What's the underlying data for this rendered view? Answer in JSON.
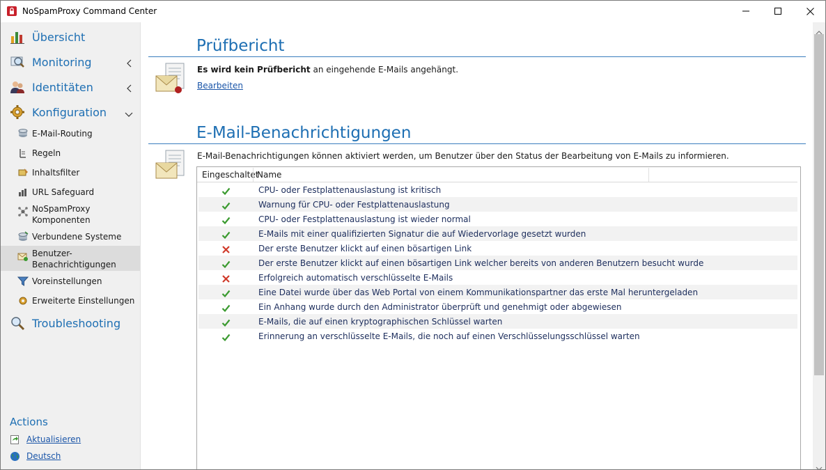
{
  "window": {
    "title": "NoSpamProxy Command Center"
  },
  "sidebar": {
    "main_items": [
      {
        "label": "Übersicht",
        "icon": "overview-chart-icon",
        "chevron": ""
      },
      {
        "label": "Monitoring",
        "icon": "monitoring-magnifier-icon",
        "chevron": "left"
      },
      {
        "label": "Identitäten",
        "icon": "identities-users-icon",
        "chevron": "left"
      },
      {
        "label": "Konfiguration",
        "icon": "configuration-gear-icon",
        "chevron": "down"
      }
    ],
    "sub_items": [
      {
        "label": "E-Mail-Routing",
        "icon": "email-routing-icon"
      },
      {
        "label": "Regeln",
        "icon": "rules-icon"
      },
      {
        "label": "Inhaltsfilter",
        "icon": "content-filter-icon"
      },
      {
        "label": "URL Safeguard",
        "icon": "url-safeguard-icon"
      },
      {
        "label": "NoSpamProxy",
        "label2": "Komponenten",
        "icon": "components-icon"
      },
      {
        "label": "Verbundene Systeme",
        "icon": "connected-systems-icon"
      },
      {
        "label": "Benutzer-",
        "label2": "Benachrichtigungen",
        "icon": "user-notifications-icon",
        "selected": true
      },
      {
        "label": "Voreinstellungen",
        "icon": "presets-filter-icon"
      },
      {
        "label": "Erweiterte Einstellungen",
        "icon": "advanced-settings-icon"
      }
    ],
    "troubleshooting": {
      "label": "Troubleshooting",
      "icon": "troubleshooting-magnifier-icon"
    },
    "actions": {
      "title": "Actions",
      "items": [
        {
          "label": "Aktualisieren",
          "icon": "refresh-icon"
        },
        {
          "label": "Deutsch",
          "icon": "globe-icon"
        }
      ]
    }
  },
  "pruefbericht": {
    "title": "Prüfbericht",
    "text_bold": "Es wird kein Prüfbericht",
    "text_rest": " an eingehende E-Mails angehängt.",
    "edit_link": "Bearbeiten"
  },
  "notifications": {
    "title": "E-Mail-Benachrichtigungen",
    "description": "E-Mail-Benachrichtigungen können aktiviert werden, um Benutzer über den Status der Bearbeitung von E-Mails zu informieren.",
    "columns": [
      "Eingeschaltet",
      "Name"
    ],
    "rows": [
      {
        "enabled": true,
        "name": "CPU- oder Festplattenauslastung ist kritisch"
      },
      {
        "enabled": true,
        "name": "Warnung für CPU- oder Festplattenauslastung"
      },
      {
        "enabled": true,
        "name": "CPU- oder Festplattenauslastung ist wieder normal"
      },
      {
        "enabled": true,
        "name": "E-Mails mit einer qualifizierten Signatur die auf Wiedervorlage gesetzt wurden"
      },
      {
        "enabled": false,
        "name": "Der erste Benutzer klickt auf einen bösartigen Link"
      },
      {
        "enabled": true,
        "name": "Der erste Benutzer klickt auf einen bösartigen Link welcher bereits von anderen Benutzern besucht wurde"
      },
      {
        "enabled": false,
        "name": "Erfolgreich automatisch verschlüsselte E-Mails"
      },
      {
        "enabled": true,
        "name": "Eine Datei wurde über das Web Portal von einem Kommunikationspartner das erste Mal heruntergeladen"
      },
      {
        "enabled": true,
        "name": "Ein Anhang wurde durch den Administrator überprüft und genehmigt oder abgewiesen"
      },
      {
        "enabled": true,
        "name": "E-Mails, die auf einen kryptographischen Schlüssel warten"
      },
      {
        "enabled": true,
        "name": "Erinnerung an verschlüsselte E-Mails, die noch auf einen Verschlüsselungsschlüssel warten"
      }
    ]
  },
  "colors": {
    "accent": "#1e6fb3",
    "check": "#3a9a2f",
    "cross": "#d03a2a"
  }
}
